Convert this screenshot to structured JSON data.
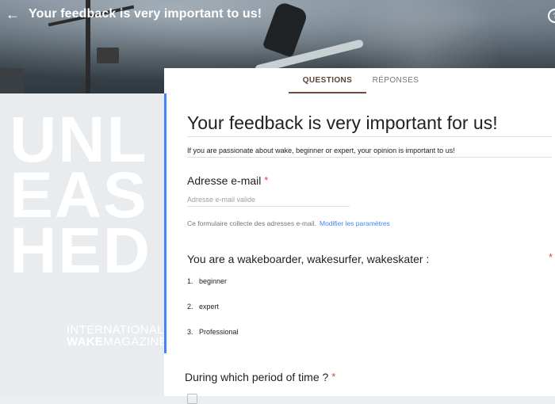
{
  "header": {
    "back_icon": "arrow-back-icon",
    "title": "Your feedback is very important to us!",
    "help_icon": "help-icon"
  },
  "tabs": [
    {
      "label": "QUESTIONS",
      "active": true
    },
    {
      "label": "RÉPONSES",
      "active": false
    }
  ],
  "sidebar": {
    "letters": [
      "UNL",
      "EAS",
      "HED"
    ],
    "line1": "INTERNATIONAL",
    "line2_bold": "WAKE",
    "line2_rest": "MAGAZINE"
  },
  "form": {
    "title": "Your feedback is very important for us!",
    "description": "If you are passionate about wake, beginner or expert, your opinion is important to us!"
  },
  "email_question": {
    "title": "Adresse e-mail",
    "required_mark": "*",
    "placeholder": "Adresse e-mail valide",
    "note": "Ce formulaire collecte des adresses e-mail.",
    "link": "Modifier les paramètres"
  },
  "wake_question": {
    "title": "You are a wakeboarder, wakesurfer, wakeskater :",
    "required_mark": "*",
    "options": [
      {
        "num": "1.",
        "label": "beginner"
      },
      {
        "num": "2.",
        "label": "expert"
      },
      {
        "num": "3.",
        "label": "Professional"
      }
    ]
  },
  "period_question": {
    "title": "During which period of time ?",
    "required_mark": "*"
  },
  "colors": {
    "accent": "#4285f4",
    "tab_active": "#6d4c41",
    "required": "#db4437"
  }
}
